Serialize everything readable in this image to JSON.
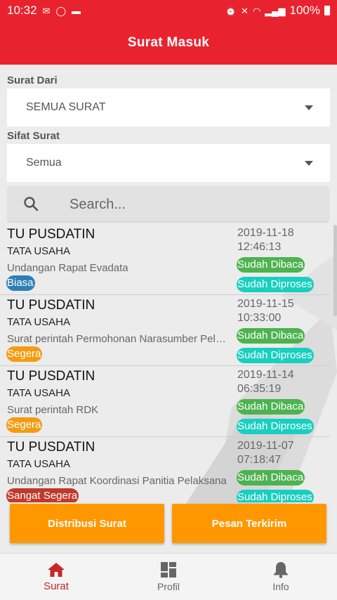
{
  "status_bar": {
    "time": "10:32",
    "battery": "100%"
  },
  "app_bar": {
    "title": "Surat Masuk"
  },
  "filters": {
    "surat_dari_label": "Surat Dari",
    "surat_dari_value": "SEMUA SURAT",
    "sifat_label": "Sifat Surat",
    "sifat_value": "Semua"
  },
  "search": {
    "placeholder": "Search..."
  },
  "letters": [
    {
      "sender": "TU PUSDATIN",
      "unit": "TATA USAHA",
      "subject": "Undangan Rapat Evadata",
      "sifat": "Biasa",
      "sifat_color": "#2f7fb5",
      "date": "2019-11-18",
      "time": "12:46:13",
      "read_status": "Sudah Dibaca",
      "process_status": "Sudah Diproses"
    },
    {
      "sender": "TU PUSDATIN",
      "unit": "TATA USAHA",
      "subject": "Surat perintah Permohonan Narasumber Pelatihan",
      "sifat": "Segera",
      "sifat_color": "#f39c12",
      "date": "2019-11-15",
      "time": "10:33:00",
      "read_status": "Sudah Dibaca",
      "process_status": "Sudah Diproses"
    },
    {
      "sender": "TU PUSDATIN",
      "unit": "TATA USAHA",
      "subject": "Surat perintah RDK",
      "sifat": "Segera",
      "sifat_color": "#f39c12",
      "date": "2019-11-14",
      "time": "06:35:19",
      "read_status": "Sudah Dibaca",
      "process_status": "Sudah Diproses"
    },
    {
      "sender": "TU PUSDATIN",
      "unit": "TATA USAHA",
      "subject": "Undangan Rapat Koordinasi Panitia Pelaksana",
      "sifat": "Sangat Segera",
      "sifat_color": "#c0392b",
      "date": "2019-11-07",
      "time": "07:18:47",
      "read_status": "Sudah Dibaca",
      "process_status": "Sudah Diproses"
    }
  ],
  "actions": {
    "distribusi": "Distribusi Surat",
    "pesan": "Pesan Terkirim"
  },
  "nav": {
    "surat": "Surat",
    "profil": "Profil",
    "info": "Info",
    "active_color": "#c62828",
    "inactive_color": "#666666"
  },
  "colors": {
    "primary": "#e8232f",
    "accent": "#ff9800",
    "read": "#4db34f",
    "processed": "#18cfc0"
  }
}
